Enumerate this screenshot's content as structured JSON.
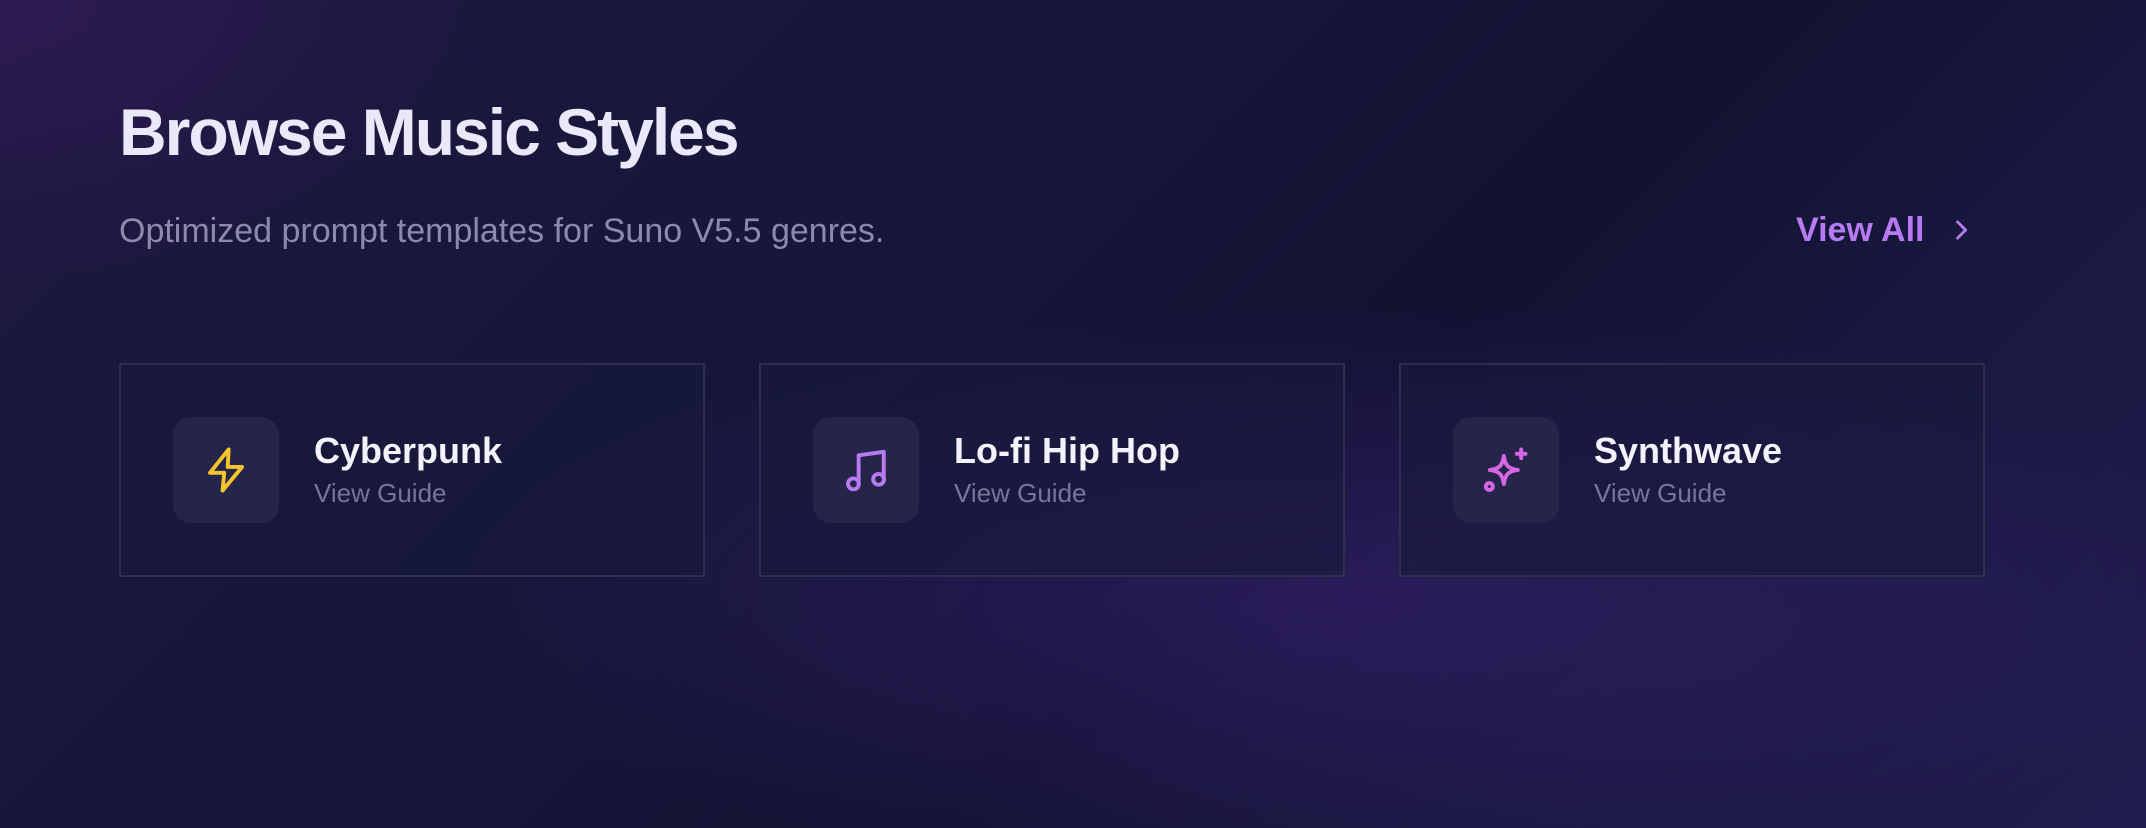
{
  "header": {
    "title": "Browse Music Styles",
    "subtitle": "Optimized prompt templates for Suno V5.5 genres.",
    "view_all_label": "View All"
  },
  "cards": [
    {
      "title": "Cyberpunk",
      "subtitle": "View Guide",
      "icon": "lightning-bolt-icon",
      "icon_color": "#f6c42b"
    },
    {
      "title": "Lo-fi Hip Hop",
      "subtitle": "View Guide",
      "icon": "music-note-icon",
      "icon_color": "#b77af3"
    },
    {
      "title": "Synthwave",
      "subtitle": "View Guide",
      "icon": "sparkles-icon",
      "icon_color": "#d766e6"
    }
  ],
  "colors": {
    "accent": "#b77af3",
    "title": "#ece8fb",
    "muted": "#8d8aab"
  }
}
